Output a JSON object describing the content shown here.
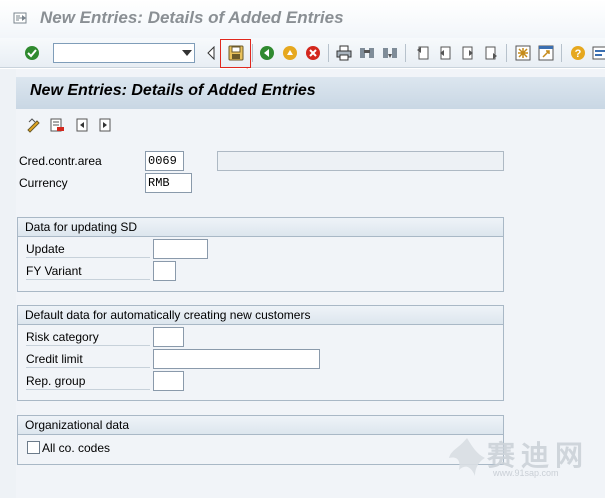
{
  "window": {
    "title": "New Entries: Details of Added Entries"
  },
  "toolbar": {
    "command_field_value": "",
    "buttons": [
      {
        "name": "enter-icon"
      },
      {
        "name": "save-icon"
      },
      {
        "name": "back-icon"
      },
      {
        "name": "exit-icon"
      },
      {
        "name": "cancel-icon"
      },
      {
        "name": "print-icon"
      },
      {
        "name": "find-icon"
      },
      {
        "name": "find-next-icon"
      },
      {
        "name": "first-page-icon"
      },
      {
        "name": "previous-page-icon"
      },
      {
        "name": "next-page-icon"
      },
      {
        "name": "last-page-icon"
      },
      {
        "name": "create-session-icon"
      },
      {
        "name": "shortcut-icon"
      },
      {
        "name": "help-icon"
      },
      {
        "name": "customize-layout-icon"
      }
    ]
  },
  "screen": {
    "header": "New Entries: Details of Added Entries"
  },
  "form": {
    "cred_contr_area": {
      "label": "Cred.contr.area",
      "value": "0069",
      "description": ""
    },
    "currency": {
      "label": "Currency",
      "value": "RMB"
    }
  },
  "groups": {
    "updating_sd": {
      "title": "Data for updating SD",
      "update": {
        "label": "Update",
        "value": ""
      },
      "fy_variant": {
        "label": "FY Variant",
        "value": ""
      }
    },
    "default_data": {
      "title": "Default data for automatically creating new customers",
      "risk_category": {
        "label": "Risk category",
        "value": ""
      },
      "credit_limit": {
        "label": "Credit limit",
        "value": ""
      },
      "rep_group": {
        "label": "Rep. group",
        "value": ""
      }
    },
    "organizational": {
      "title": "Organizational data",
      "all_co_codes": {
        "label": "All co. codes",
        "checked": false
      }
    }
  },
  "watermark": {
    "text": "赛迪网",
    "url": "www.91sap.com"
  },
  "colors": {
    "highlight": "#e0281e",
    "header_bg": "#c9d7e4"
  }
}
